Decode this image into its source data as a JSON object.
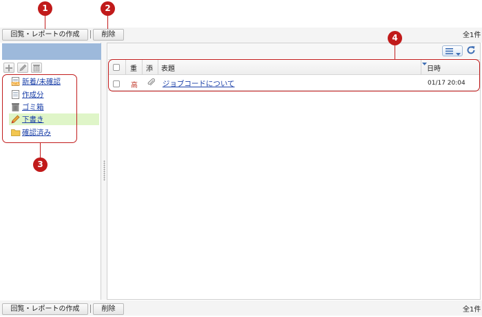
{
  "toolbar_top": {
    "create_label": "回覧・レポートの作成",
    "delete_label": "削除",
    "count_label": "全1件"
  },
  "toolbar_bottom": {
    "create_label": "回覧・レポートの作成",
    "delete_label": "削除",
    "count_label": "全1件"
  },
  "left_toolbar": {
    "icons": [
      "plus-icon",
      "pencil-icon",
      "trash-icon"
    ]
  },
  "folders": [
    {
      "label": "新着/未確認",
      "icon": "new-unconfirmed-icon",
      "selected": false
    },
    {
      "label": "作成分",
      "icon": "document-icon",
      "selected": false
    },
    {
      "label": "ゴミ箱",
      "icon": "trash-can-icon",
      "selected": false
    },
    {
      "label": "下書き",
      "icon": "pencil-draft-icon",
      "selected": true
    },
    {
      "label": "確認済み",
      "icon": "folder-icon",
      "selected": false
    }
  ],
  "grid": {
    "columns": {
      "priority": "重",
      "attachment": "添",
      "subject": "表題",
      "datetime": "日時"
    },
    "rows": [
      {
        "priority": "高",
        "has_attachment": true,
        "subject": "ジョブコードについて",
        "datetime": "01/17 20:04"
      }
    ]
  },
  "callouts": [
    "1",
    "2",
    "3",
    "4"
  ],
  "colors": {
    "callout": "#c11a1a",
    "link": "#1a3fa8",
    "priority_high": "#c0392b",
    "selected_folder": "#dff5c8",
    "left_header": "#9db9db"
  }
}
